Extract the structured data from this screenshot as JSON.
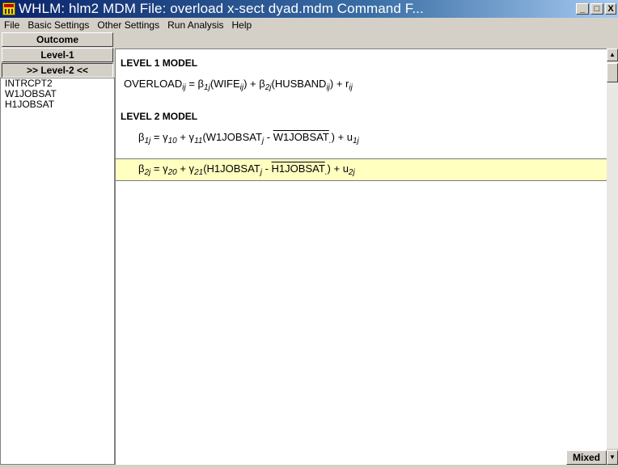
{
  "window": {
    "title": "WHLM: hlm2 MDM File: overload x-sect dyad.mdm   Command F...",
    "minimize": "_",
    "maximize": "□",
    "close": "X"
  },
  "menu": [
    "File",
    "Basic Settings",
    "Other Settings",
    "Run Analysis",
    "Help"
  ],
  "sidebar": {
    "outcome_label": "Outcome",
    "level1_label": "Level-1",
    "level2_label": ">> Level-2 <<",
    "variables": [
      "INTRCPT2",
      "W1JOBSAT",
      "H1JOBSAT"
    ]
  },
  "model": {
    "level1_heading": "LEVEL 1 MODEL",
    "level2_heading": "LEVEL 2 MODEL",
    "level1_eq": {
      "lhs": "OVERLOAD",
      "lhs_sub": "ij",
      "b1": "β",
      "b1_sub": "1j",
      "v1": "(WIFE",
      "v1_sub": "ij",
      "b2": ") + β",
      "b2_sub": "2j",
      "v2": "(HUSBAND",
      "v2_sub": "ij",
      "err": ") + r",
      "err_sub": "ij"
    },
    "level2_eq1": {
      "beta": "β",
      "beta_sub": "1j",
      "g0": " =  γ",
      "g0_sub": "10",
      "g1": " + γ",
      "g1_sub": "11",
      "var": "(W1JOBSAT",
      "var_sub": "j",
      "minus": " - ",
      "mean": "W1JOBSAT",
      "mean_sub": ".",
      "err": ") + u",
      "err_sub": "1j"
    },
    "level2_eq2": {
      "beta": "β",
      "beta_sub": "2j",
      "g0": " =  γ",
      "g0_sub": "20",
      "g1": " + γ",
      "g1_sub": "21",
      "var": "(H1JOBSAT",
      "var_sub": "j",
      "minus": " - ",
      "mean": "H1JOBSAT",
      "mean_sub": ".",
      "err": ") + u",
      "err_sub": "2j"
    }
  },
  "footer": {
    "mixed_label": "Mixed"
  },
  "scrollbar": {
    "up_arrow": "▲",
    "down_arrow": "▼"
  }
}
